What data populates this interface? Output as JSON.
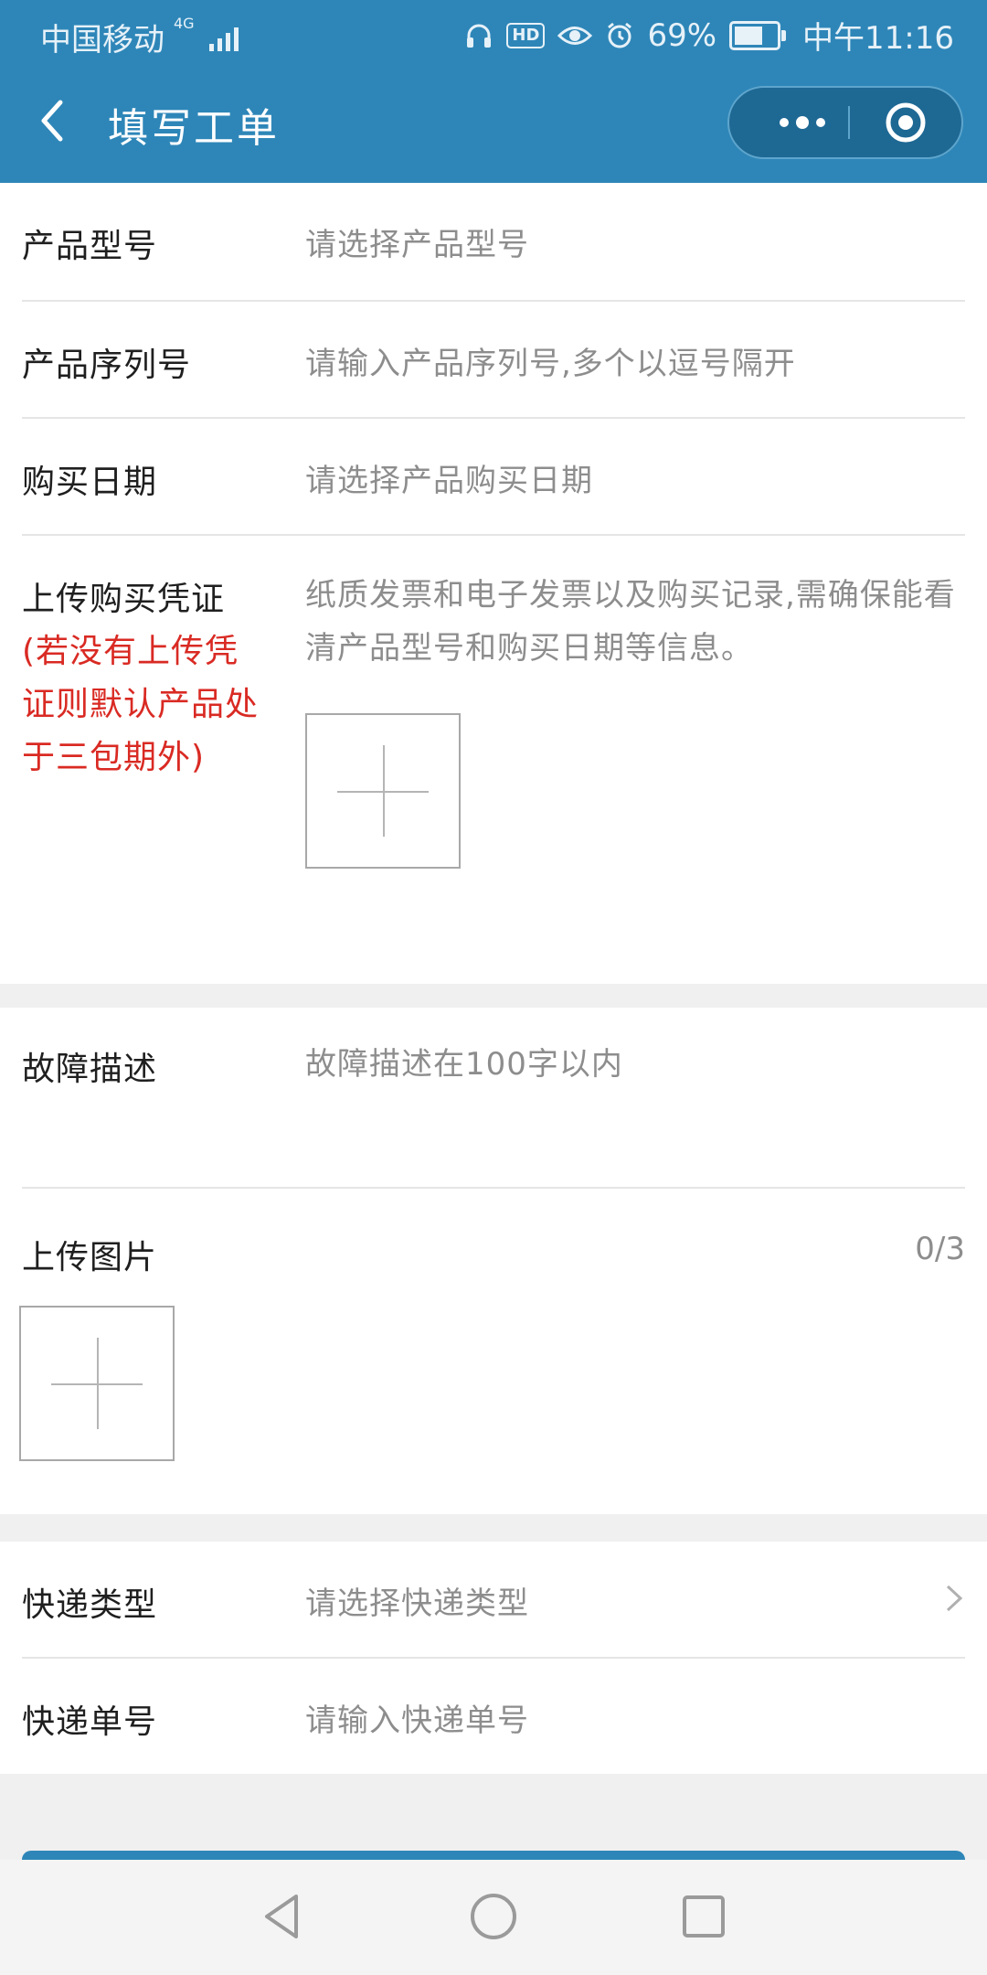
{
  "status_bar": {
    "carrier": "中国移动",
    "network": "4G",
    "battery": "69%",
    "battery_level": 0.69,
    "hd_label": "HD",
    "time": "中午11:16"
  },
  "nav": {
    "title": "填写工单",
    "back_icon": "chevron-left-icon",
    "more_icon": "more-dots-icon",
    "close_icon": "target-circle-icon"
  },
  "form": {
    "product_model": {
      "label": "产品型号",
      "placeholder": "请选择产品型号"
    },
    "serial_number": {
      "label": "产品序列号",
      "placeholder": "请输入产品序列号,多个以逗号隔开"
    },
    "purchase_date": {
      "label": "购买日期",
      "placeholder": "请选择产品购买日期"
    },
    "receipt": {
      "label": "上传购买凭证",
      "note": "(若没有上传凭证则默认产品处于三包期外)",
      "hint": "纸质发票和电子发票以及购买记录,需确保能看清产品型号和购买日期等信息。"
    },
    "fault": {
      "label": "故障描述",
      "placeholder": "故障描述在100字以内"
    },
    "images": {
      "label": "上传图片",
      "counter": "0/3"
    },
    "courier_type": {
      "label": "快递类型",
      "placeholder": "请选择快递类型"
    },
    "tracking_number": {
      "label": "快递单号",
      "placeholder": "请输入快递单号"
    }
  },
  "colors": {
    "primary": "#2e86b8",
    "warning": "#d92a23",
    "placeholder": "#8d8d8d"
  }
}
